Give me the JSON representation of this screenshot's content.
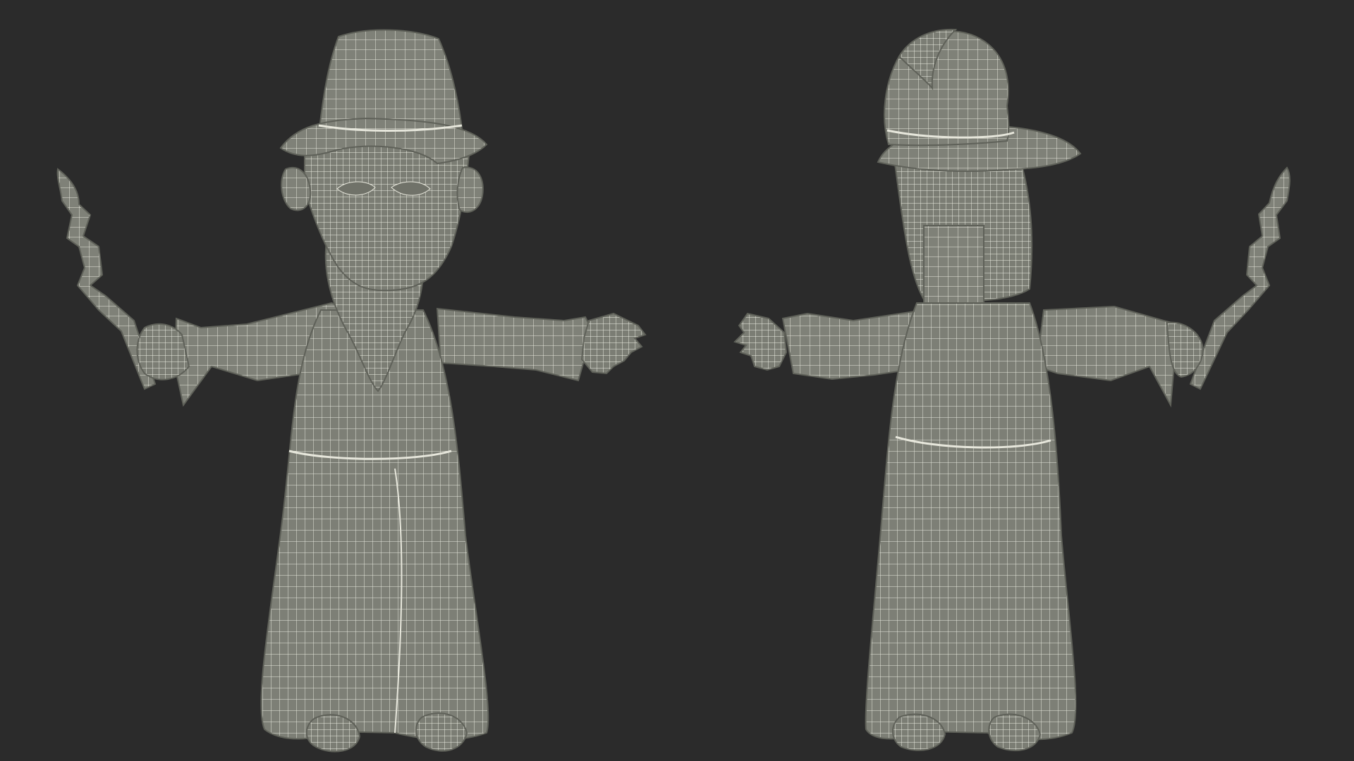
{
  "scene": {
    "background_color": "#2b2b2b",
    "mesh_color": "#7f8178",
    "wire_color": "#e7e7dc",
    "views": [
      {
        "name": "front-view"
      },
      {
        "name": "back-view"
      }
    ]
  }
}
